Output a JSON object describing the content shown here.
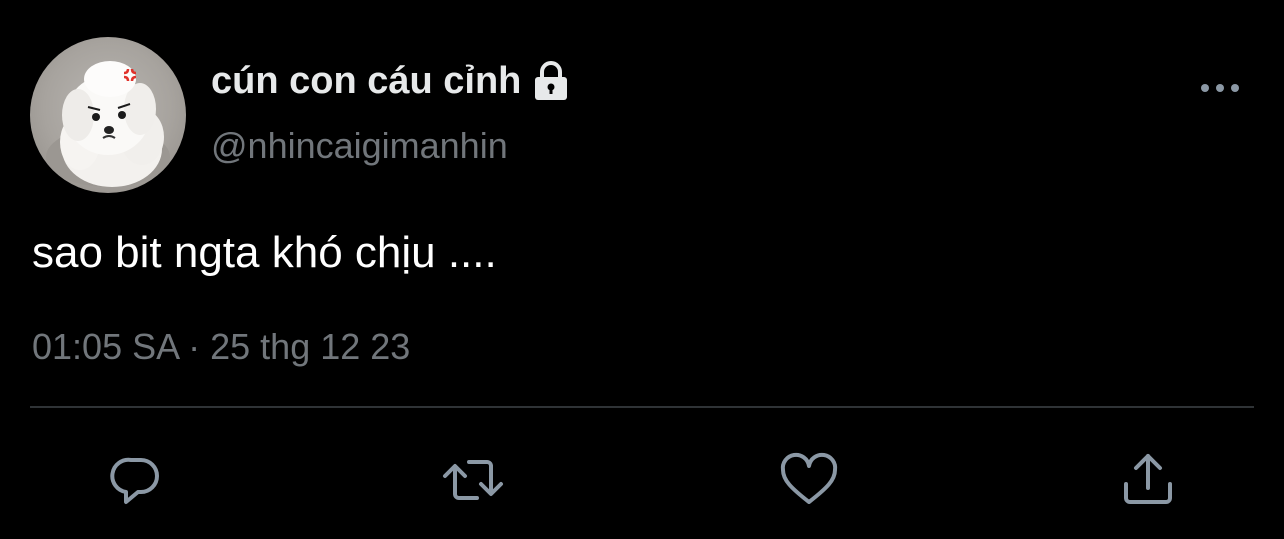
{
  "tweet": {
    "display_name": "cún con cáu cỉnh",
    "handle": "@nhincaigimanhin",
    "text": "sao bit ngta khó chịu ....",
    "timestamp": "01:05 SA · 25 thg 12 23",
    "protected_icon": "lock-icon",
    "more_icon": "more-icon"
  },
  "actions": [
    {
      "icon": "reply-icon"
    },
    {
      "icon": "retweet-icon"
    },
    {
      "icon": "like-icon"
    },
    {
      "icon": "share-icon"
    }
  ],
  "colors": {
    "background": "#000000",
    "primary_text": "#ffffff",
    "secondary_text": "#71767b",
    "divider": "#2f3336",
    "icon": "#8b98a5"
  }
}
